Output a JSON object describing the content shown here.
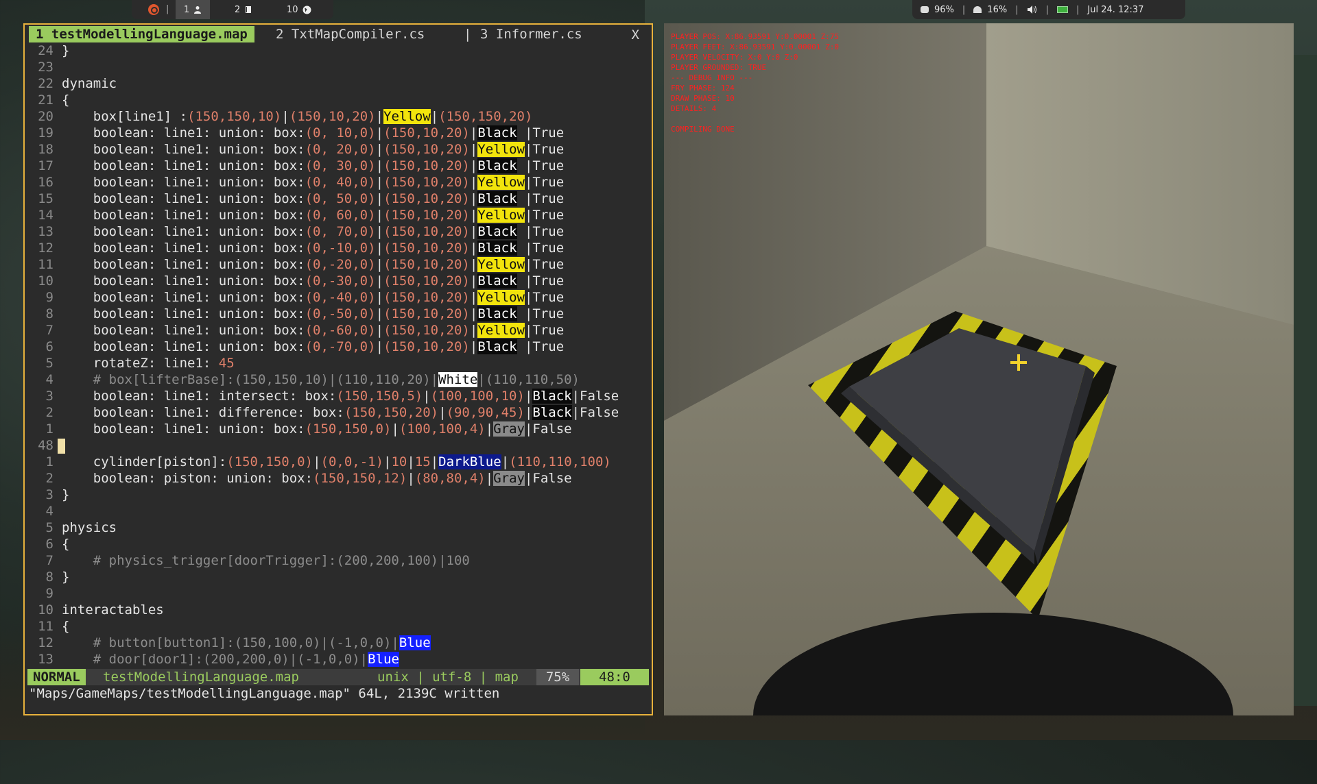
{
  "topbar": {
    "separator": "|",
    "workspaces": [
      {
        "label": "1",
        "icon": "person-icon",
        "active": true
      },
      {
        "label": "2",
        "icon": "book-icon",
        "active": false
      },
      {
        "label": "10",
        "icon": "globe-icon",
        "active": false
      }
    ],
    "cpu": "96%",
    "disk": "16%",
    "datetime": "Jul 24. 12:37"
  },
  "vim": {
    "tabs": {
      "active": "1 testModellingLanguage.map",
      "tab2": "2 TxtMapCompiler.cs",
      "divider": "|",
      "tab3": "3 Informer.cs",
      "close": "X"
    },
    "lines": [
      {
        "n": "24",
        "t": "}"
      },
      {
        "n": "23",
        "t": ""
      },
      {
        "n": "22",
        "t": "dynamic"
      },
      {
        "n": "21",
        "t": "{"
      },
      {
        "n": "20",
        "pre": "    box[line1] :",
        "a": "(150,150,10)",
        "m": "|",
        "b": "(150,10,20)",
        "m2": "|",
        "color": "Yellow",
        "cls": "hl-yellow",
        "post": "|",
        "c": "(150,150,20)"
      },
      {
        "n": "19",
        "pre": "    boolean: line1: union: box:",
        "a": "(0, 10,0)",
        "m": "|",
        "b": "(150,10,20)",
        "m2": "|",
        "color": "Black",
        "cls": "hl-black",
        "post": " |True"
      },
      {
        "n": "18",
        "pre": "    boolean: line1: union: box:",
        "a": "(0, 20,0)",
        "m": "|",
        "b": "(150,10,20)",
        "m2": "|",
        "color": "Yellow",
        "cls": "hl-yellow",
        "post": "|True"
      },
      {
        "n": "17",
        "pre": "    boolean: line1: union: box:",
        "a": "(0, 30,0)",
        "m": "|",
        "b": "(150,10,20)",
        "m2": "|",
        "color": "Black",
        "cls": "hl-black",
        "post": " |True"
      },
      {
        "n": "16",
        "pre": "    boolean: line1: union: box:",
        "a": "(0, 40,0)",
        "m": "|",
        "b": "(150,10,20)",
        "m2": "|",
        "color": "Yellow",
        "cls": "hl-yellow",
        "post": "|True"
      },
      {
        "n": "15",
        "pre": "    boolean: line1: union: box:",
        "a": "(0, 50,0)",
        "m": "|",
        "b": "(150,10,20)",
        "m2": "|",
        "color": "Black",
        "cls": "hl-black",
        "post": " |True"
      },
      {
        "n": "14",
        "pre": "    boolean: line1: union: box:",
        "a": "(0, 60,0)",
        "m": "|",
        "b": "(150,10,20)",
        "m2": "|",
        "color": "Yellow",
        "cls": "hl-yellow",
        "post": "|True"
      },
      {
        "n": "13",
        "pre": "    boolean: line1: union: box:",
        "a": "(0, 70,0)",
        "m": "|",
        "b": "(150,10,20)",
        "m2": "|",
        "color": "Black",
        "cls": "hl-black",
        "post": " |True"
      },
      {
        "n": "12",
        "pre": "    boolean: line1: union: box:",
        "a": "(0,-10,0)",
        "m": "|",
        "b": "(150,10,20)",
        "m2": "|",
        "color": "Black",
        "cls": "hl-black",
        "post": " |True"
      },
      {
        "n": "11",
        "pre": "    boolean: line1: union: box:",
        "a": "(0,-20,0)",
        "m": "|",
        "b": "(150,10,20)",
        "m2": "|",
        "color": "Yellow",
        "cls": "hl-yellow",
        "post": "|True"
      },
      {
        "n": "10",
        "pre": "    boolean: line1: union: box:",
        "a": "(0,-30,0)",
        "m": "|",
        "b": "(150,10,20)",
        "m2": "|",
        "color": "Black",
        "cls": "hl-black",
        "post": " |True"
      },
      {
        "n": "9",
        "pre": "    boolean: line1: union: box:",
        "a": "(0,-40,0)",
        "m": "|",
        "b": "(150,10,20)",
        "m2": "|",
        "color": "Yellow",
        "cls": "hl-yellow",
        "post": "|True"
      },
      {
        "n": "8",
        "pre": "    boolean: line1: union: box:",
        "a": "(0,-50,0)",
        "m": "|",
        "b": "(150,10,20)",
        "m2": "|",
        "color": "Black",
        "cls": "hl-black",
        "post": " |True"
      },
      {
        "n": "7",
        "pre": "    boolean: line1: union: box:",
        "a": "(0,-60,0)",
        "m": "|",
        "b": "(150,10,20)",
        "m2": "|",
        "color": "Yellow",
        "cls": "hl-yellow",
        "post": "|True"
      },
      {
        "n": "6",
        "pre": "    boolean: line1: union: box:",
        "a": "(0,-70,0)",
        "m": "|",
        "b": "(150,10,20)",
        "m2": "|",
        "color": "Black",
        "cls": "hl-black",
        "post": " |True"
      },
      {
        "n": "5",
        "pre": "    rotateZ: line1: ",
        "a": "45"
      },
      {
        "n": "4",
        "cmt": "    # box[lifterBase]:(150,150,10)|(110,110,20)|",
        "color": "White",
        "cls": "hl-white",
        "cmt2": "|(110,110,50)"
      },
      {
        "n": "3",
        "pre": "    boolean: line1: intersect: box:",
        "a": "(150,150,5)",
        "m": "|",
        "b": "(100,100,10)",
        "m2": "|",
        "color": "Black",
        "cls": "hl-black",
        "post": "|False"
      },
      {
        "n": "2",
        "pre": "    boolean: line1: difference: box:",
        "a": "(150,150,20)",
        "m": "|",
        "b": "(90,90,45)",
        "m2": "|",
        "color": "Black",
        "cls": "hl-black",
        "post": "|False"
      },
      {
        "n": "1",
        "pre": "    boolean: line1: union: box:",
        "a": "(150,150,0)",
        "m": "|",
        "b": "(100,100,4)",
        "m2": "|",
        "color": "Gray",
        "cls": "hl-gray",
        "post": "|False"
      },
      {
        "n": "48",
        "cursor": true
      },
      {
        "n": "1",
        "pre": "    cylinder[piston]:",
        "a": "(150,150,0)",
        "m": "|",
        "b": "(0,0,-1)",
        "m2": "|",
        "mid": "10",
        "m3": "|",
        "mid2": "15",
        "m4": "|",
        "color": "DarkBlue",
        "cls": "hl-darkblue",
        "post": "|",
        "c": "(110,110,100)"
      },
      {
        "n": "2",
        "pre": "    boolean: piston: union: box:",
        "a": "(150,150,12)",
        "m": "|",
        "b": "(80,80,4)",
        "m2": "|",
        "color": "Gray",
        "cls": "hl-gray",
        "post": "|False"
      },
      {
        "n": "3",
        "t": "}"
      },
      {
        "n": "4",
        "t": ""
      },
      {
        "n": "5",
        "t": "physics"
      },
      {
        "n": "6",
        "t": "{"
      },
      {
        "n": "7",
        "cmt": "    # physics_trigger[doorTrigger]:(200,200,100)|100"
      },
      {
        "n": "8",
        "t": "}"
      },
      {
        "n": "9",
        "t": ""
      },
      {
        "n": "10",
        "t": "interactables"
      },
      {
        "n": "11",
        "t": "{"
      },
      {
        "n": "12",
        "cmt": "    # button[button1]:(150,100,0)|(-1,0,0)|",
        "color": "Blue",
        "cls": "hl-blue"
      },
      {
        "n": "13",
        "cmt": "    # door[door1]:(200,200,0)|(-1,0,0)|",
        "color": "Blue",
        "cls": "hl-blue"
      }
    ],
    "status": {
      "mode": "NORMAL",
      "file": "testModellingLanguage.map",
      "info": "unix | utf-8 | map",
      "percent": "75%",
      "position": "48:0"
    },
    "cmdline": "\"Maps/GameMaps/testModellingLanguage.map\" 64L, 2139C written"
  },
  "game": {
    "debug_lines": [
      "PLAYER POS:  X:86.93591 Y:0.00001 Z:75",
      "PLAYER FEET:  X:86.93591 Y:0.00001 Z:0",
      "PLAYER VELOCITY:  X:0 Y:0 Z:0",
      "PLAYER GROUNDED: TRUE",
      "--- DEBUG INFO ---",
      " FRY PHASE: 124",
      " DRAW PHASE: 10",
      "DETAILS: 4",
      "",
      "COMPILING DONE"
    ]
  }
}
